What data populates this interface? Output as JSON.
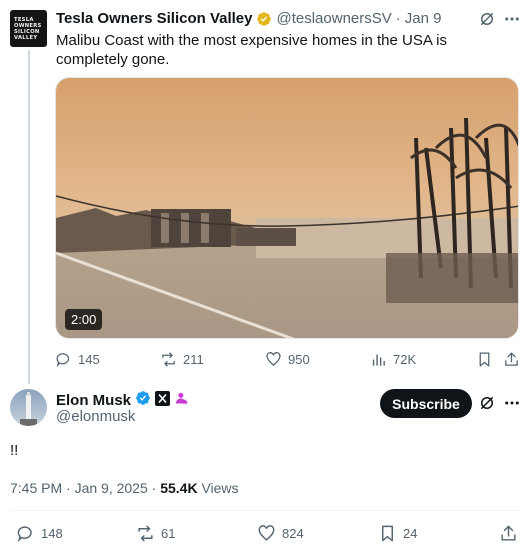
{
  "parent_tweet": {
    "avatar_lines": [
      "TESLA",
      "OWNERS",
      "SILICON",
      "VALLEY"
    ],
    "display_name": "Tesla Owners Silicon Valley",
    "handle": "@teslaownersSV",
    "separator": "·",
    "date": "Jan 9",
    "text": "Malibu Coast with the most expensive homes in the USA is completely gone.",
    "video_duration": "2:00",
    "actions": {
      "replies": "145",
      "reposts": "211",
      "likes": "950",
      "views": "72K"
    }
  },
  "main_tweet": {
    "display_name": "Elon Musk",
    "handle": "@elonmusk",
    "subscribe_label": "Subscribe",
    "text": "!!",
    "time": "7:45 PM · Jan 9, 2025 · ",
    "views_count": "55.4K",
    "views_label": " Views",
    "actions": {
      "replies": "148",
      "reposts": "61",
      "likes": "824",
      "bookmarks": "24"
    }
  },
  "colors": {
    "verified_gold": "#e2b719",
    "verified_blue": "#1d9bf0",
    "subscribe_bg": "#0f1419",
    "muted": "#536471"
  }
}
